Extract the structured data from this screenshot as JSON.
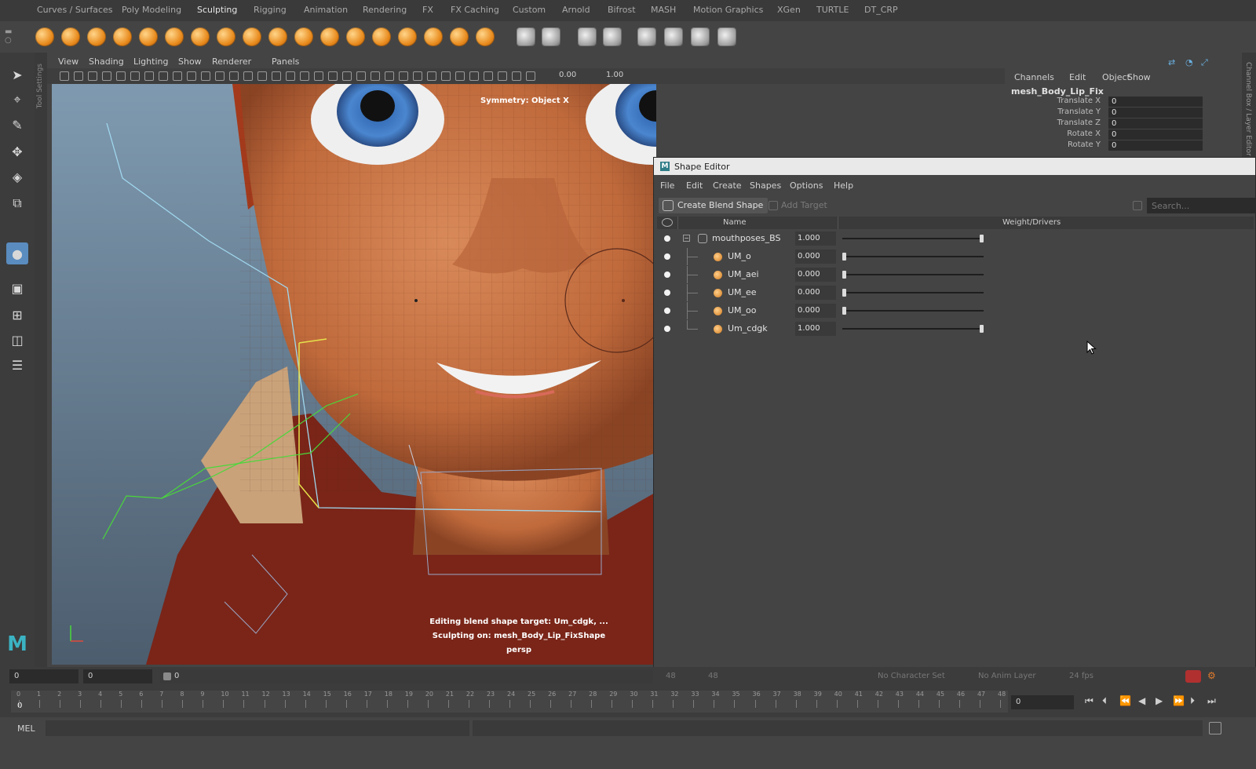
{
  "shelf_tabs": [
    "Curves / Surfaces",
    "Poly Modeling",
    "Sculpting",
    "Rigging",
    "Animation",
    "Rendering",
    "FX",
    "FX Caching",
    "Custom",
    "Arnold",
    "Bifrost",
    "MASH",
    "Motion Graphics",
    "XGen",
    "TURTLE",
    "DT_CRP"
  ],
  "active_shelf_tab": "Sculpting",
  "panel_menu": [
    "View",
    "Shading",
    "Lighting",
    "Show",
    "Renderer",
    "Panels"
  ],
  "panel_toolbar": {
    "value_a": "0.00",
    "value_b": "1.00"
  },
  "viewport": {
    "hud_top": "Symmetry: Object X",
    "hud_line1": "Editing blend shape target: Um_cdgk, ...",
    "hud_line2": "Sculpting on: mesh_Body_Lip_FixShape",
    "camera": "persp"
  },
  "channel_box": {
    "menu": [
      "Channels",
      "Edit",
      "Object",
      "Show"
    ],
    "object": "mesh_Body_Lip_Fix",
    "attributes": [
      {
        "label": "Translate X",
        "value": "0"
      },
      {
        "label": "Translate Y",
        "value": "0"
      },
      {
        "label": "Translate Z",
        "value": "0"
      },
      {
        "label": "Rotate X",
        "value": "0"
      },
      {
        "label": "Rotate Y",
        "value": "0"
      }
    ],
    "side_label": "Channel Box / Layer Editor"
  },
  "shape_editor": {
    "title": "Shape Editor",
    "menu": [
      "File",
      "Edit",
      "Create",
      "Shapes",
      "Options",
      "Help"
    ],
    "create_button": "Create Blend Shape",
    "add_target_button": "Add Target",
    "search_placeholder": "Search...",
    "columns": {
      "name": "Name",
      "weight": "Weight/Drivers"
    },
    "blend_shape": {
      "name": "mouthposes_BS",
      "weight": "1.000",
      "weight_value": 1.0
    },
    "targets": [
      {
        "name": "UM_o",
        "weight": "0.000",
        "weight_value": 0.0
      },
      {
        "name": "UM_aei",
        "weight": "0.000",
        "weight_value": 0.0
      },
      {
        "name": "UM_ee",
        "weight": "0.000",
        "weight_value": 0.0
      },
      {
        "name": "UM_oo",
        "weight": "0.000",
        "weight_value": 0.0
      },
      {
        "name": "Um_cdgk",
        "weight": "1.000",
        "weight_value": 1.0
      }
    ]
  },
  "range": {
    "start": "0",
    "start2": "0",
    "slider_val": "0",
    "end_a": "48",
    "end_b": "48",
    "character_set": "No Character Set",
    "anim_layer": "No Anim Layer",
    "fps": "24 fps"
  },
  "timeline": {
    "ticks": [
      "0",
      "1",
      "2",
      "3",
      "4",
      "5",
      "6",
      "7",
      "8",
      "9",
      "10",
      "11",
      "12",
      "13",
      "14",
      "15",
      "16",
      "17",
      "18",
      "19",
      "20",
      "21",
      "22",
      "23",
      "24",
      "25",
      "26",
      "27",
      "28",
      "29",
      "30",
      "31",
      "32",
      "33",
      "34",
      "35",
      "36",
      "37",
      "38",
      "39",
      "40",
      "41",
      "42",
      "43",
      "44",
      "45",
      "46",
      "47",
      "48"
    ],
    "current_frame": "0",
    "current_field": "0"
  },
  "command_line": {
    "label": "MEL"
  }
}
